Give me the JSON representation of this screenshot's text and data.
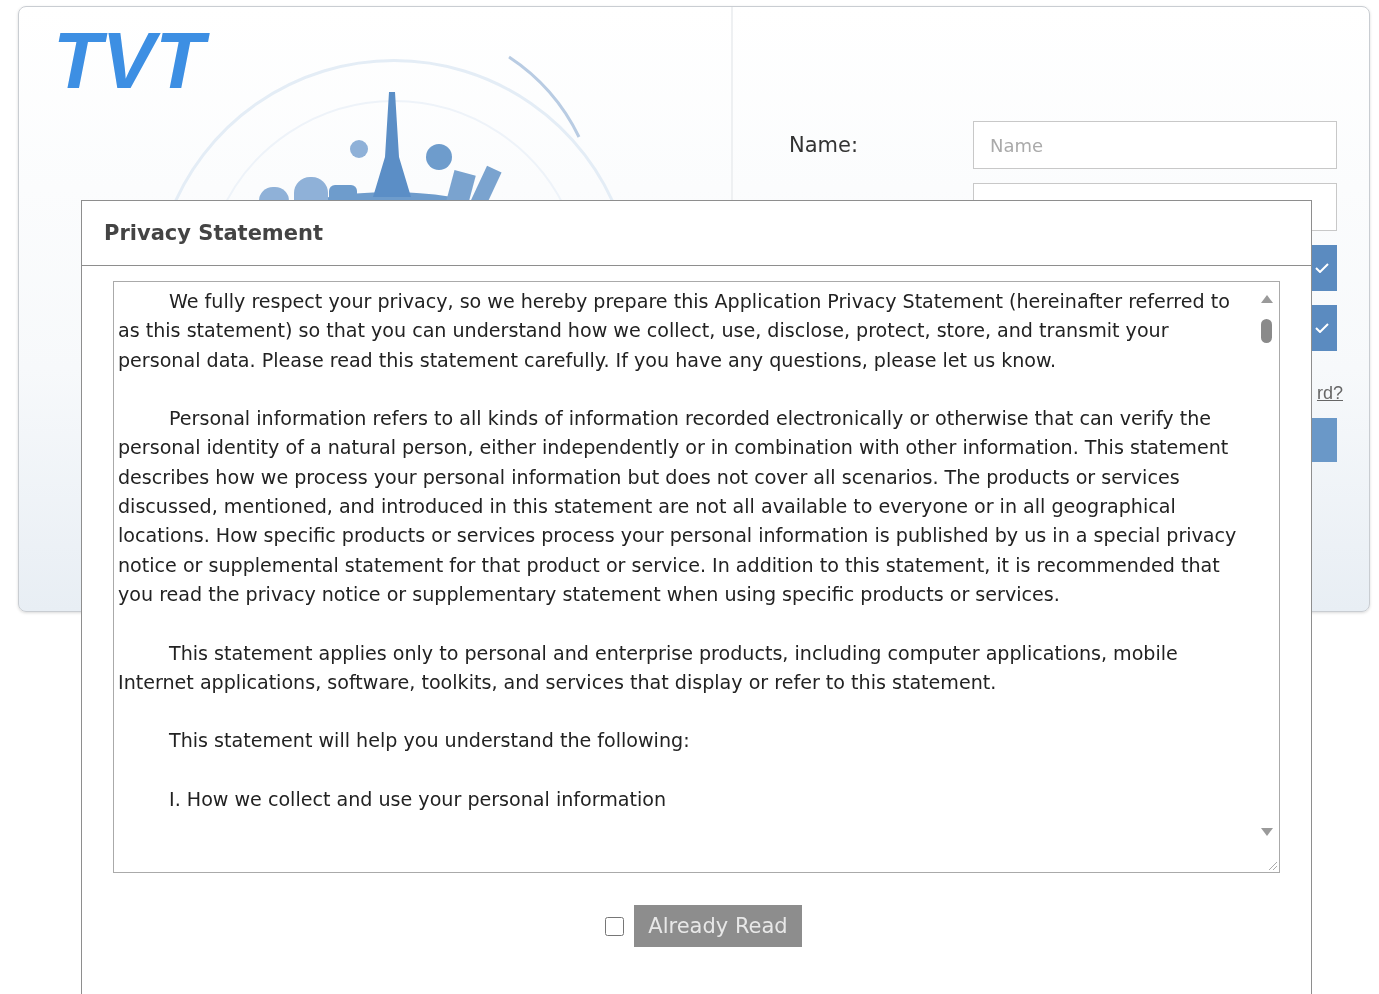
{
  "logo": {
    "text": "TVT"
  },
  "login_form": {
    "name_label": "Name:",
    "name_field": {
      "placeholder": "Name"
    },
    "link_fragment": "rd?"
  },
  "dialog": {
    "title": "Privacy Statement",
    "paragraphs": [
      "We fully respect your privacy, so we hereby prepare this Application Privacy Statement (hereinafter referred to as this statement) so that you can understand how we collect, use, disclose, protect, store, and transmit your personal data. Please read this statement carefully. If you have any questions, please let us know.",
      "Personal information refers to all kinds of information recorded electronically or otherwise that can verify the personal identity of a natural person, either independently or in combination with other information. This statement describes how we process your personal information but does not cover all scenarios. The products or services discussed, mentioned, and introduced in this statement are not all available to everyone or in all geographical locations. How specific products or services process your personal information is published by us in a special privacy notice or supplemental statement for that product or service. In addition to this statement, it is recommended that you read the privacy notice or supplementary statement when using specific products or services.",
      "This statement applies only to personal and enterprise products, including computer applications, mobile Internet applications, software, toolkits, and services that display or refer to this statement.",
      "This statement will help you understand the following:",
      "I. How we collect and use your personal information"
    ],
    "agree_checkbox": {
      "checked": false
    },
    "confirm_button": {
      "label": "Already Read",
      "disabled": true
    }
  }
}
